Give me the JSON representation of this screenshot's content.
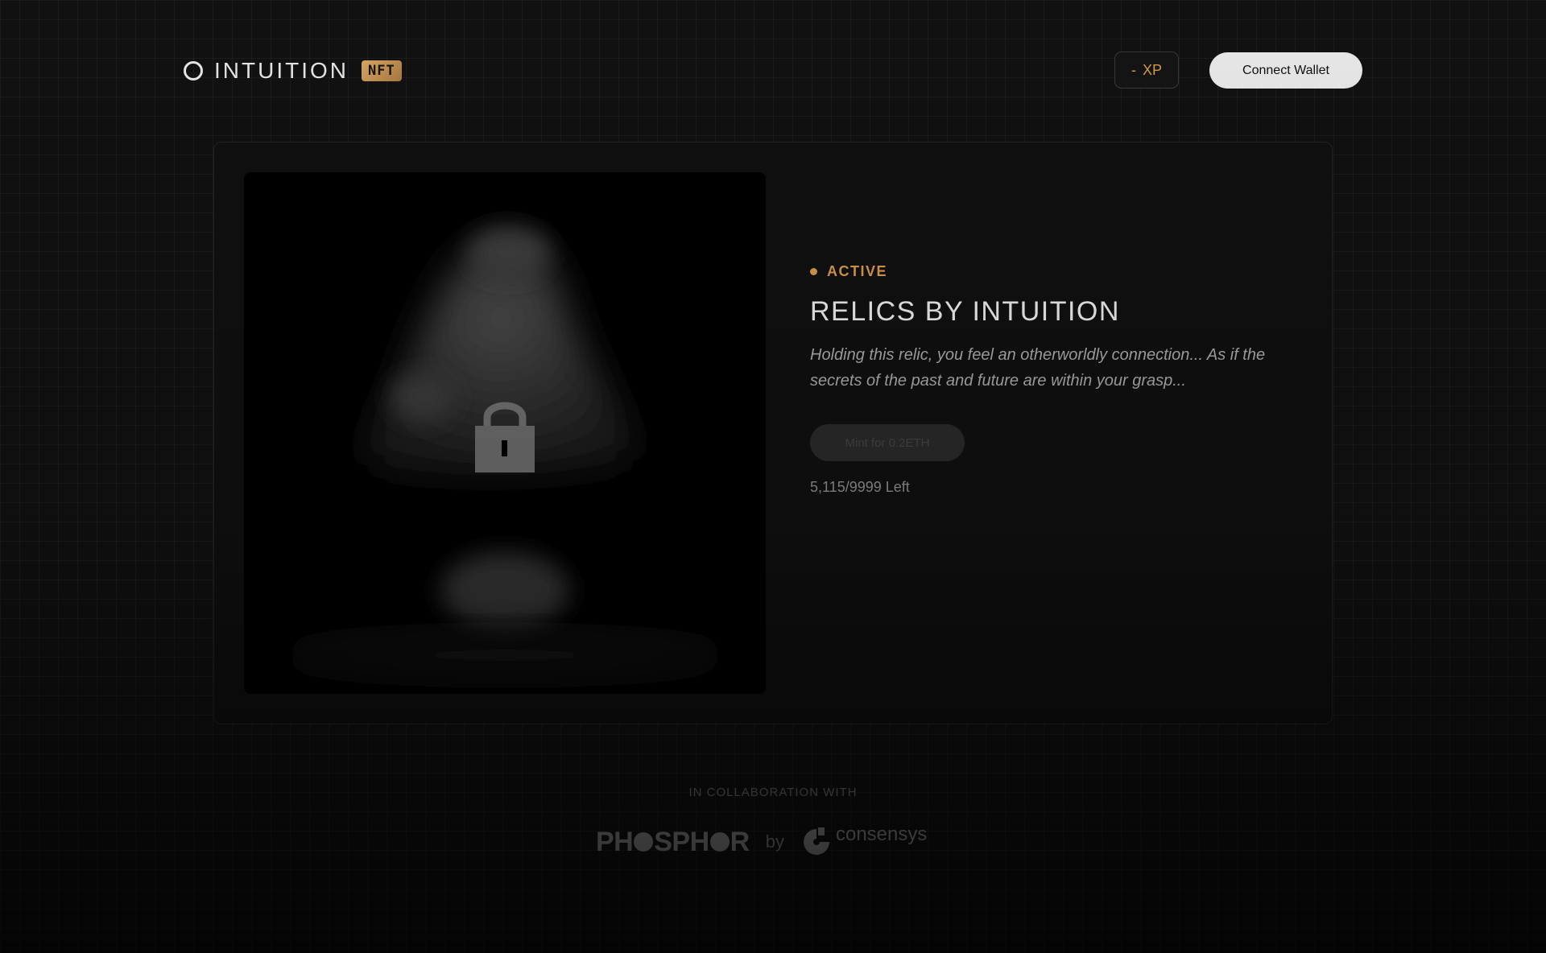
{
  "header": {
    "brand": "INTUITION",
    "badge": "NFT",
    "xp_value": "-",
    "xp_unit": "XP",
    "connect_label": "Connect Wallet"
  },
  "nft": {
    "status": "ACTIVE",
    "title": "RELICS BY INTUITION",
    "description": "Holding this relic, you feel an otherworldly connection... As if the secrets of the past and future are within your grasp...",
    "mint_label": "Mint for 0.2ETH",
    "supply": "5,115/9999 Left",
    "locked": true
  },
  "footer": {
    "collab_label": "IN COLLABORATION WITH",
    "partner1": "PH  SPH  R",
    "by": "by",
    "partner2": "consensys"
  },
  "colors": {
    "accent": "#d99a4a",
    "background": "#111111",
    "card": "#101010"
  },
  "icons": {
    "brand": "ring-logo-icon",
    "art": "lock-icon"
  }
}
